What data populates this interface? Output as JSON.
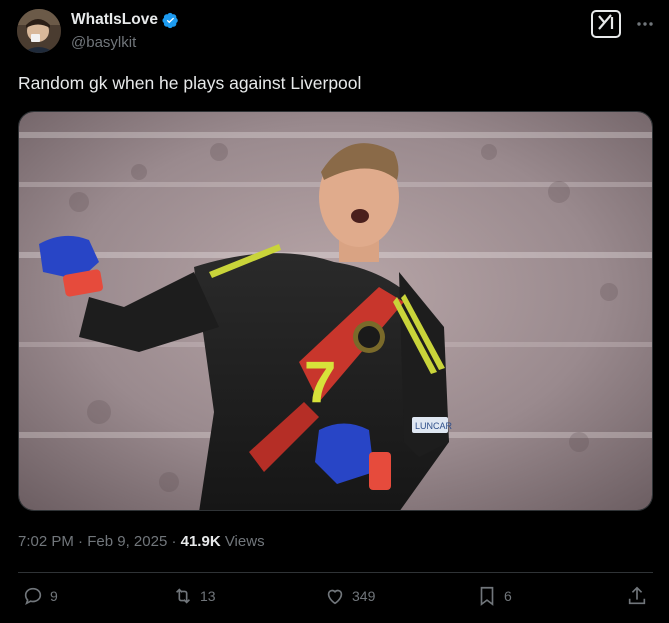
{
  "author": {
    "display_name": "WhatIsLove",
    "handle": "@basylkit",
    "verified": true
  },
  "tweet": {
    "text": "Random gk when he plays against Liverpool"
  },
  "image": {
    "player_number": "7",
    "badge_text": "LUNCAR"
  },
  "meta": {
    "time": "7:02 PM",
    "separator": " · ",
    "date": "Feb 9, 2025",
    "views_separator": " · ",
    "views_count": "41.9K",
    "views_label": " Views"
  },
  "actions": {
    "replies": "9",
    "reposts": "13",
    "likes": "349",
    "bookmarks": "6"
  },
  "icons": {
    "verified": "verified-badge-icon",
    "grok": "grok-icon",
    "more": "more-dots-icon",
    "reply": "reply-icon",
    "repost": "repost-icon",
    "like": "heart-icon",
    "bookmark": "bookmark-icon",
    "share": "share-icon"
  },
  "colors": {
    "background": "#000000",
    "text": "#e7e9ea",
    "secondary_text": "#71767b",
    "verified_blue": "#1d9bf0",
    "divider": "#2f3336"
  }
}
